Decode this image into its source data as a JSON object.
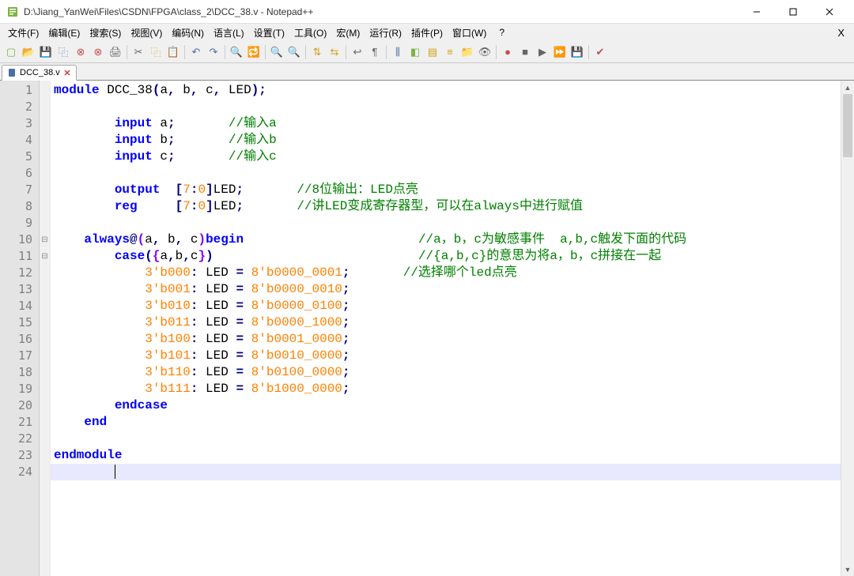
{
  "title": "D:\\Jiang_YanWei\\Files\\CSDN\\FPGA\\class_2\\DCC_38.v - Notepad++",
  "menus": [
    "文件(F)",
    "编辑(E)",
    "搜索(S)",
    "视图(V)",
    "编码(N)",
    "语言(L)",
    "设置(T)",
    "工具(O)",
    "宏(M)",
    "运行(R)",
    "插件(P)",
    "窗口(W)"
  ],
  "menu_help": "?",
  "menu_x": "X",
  "tab": {
    "label": "DCC_38.v"
  },
  "lines": [
    {
      "n": 1,
      "seg": [
        {
          "c": "kw",
          "t": "module"
        },
        {
          "t": " DCC_38"
        },
        {
          "c": "op",
          "t": "("
        },
        {
          "t": "a"
        },
        {
          "c": "op",
          "t": ","
        },
        {
          "t": " b"
        },
        {
          "c": "op",
          "t": ","
        },
        {
          "t": " c"
        },
        {
          "c": "op",
          "t": ","
        },
        {
          "t": " LED"
        },
        {
          "c": "op",
          "t": ")"
        },
        {
          "c": "op",
          "t": ";"
        }
      ]
    },
    {
      "n": 2,
      "seg": []
    },
    {
      "n": 3,
      "seg": [
        {
          "t": "        "
        },
        {
          "c": "kw",
          "t": "input"
        },
        {
          "t": " a"
        },
        {
          "c": "op",
          "t": ";"
        },
        {
          "t": "       "
        },
        {
          "c": "cm",
          "t": "//输入a"
        }
      ]
    },
    {
      "n": 4,
      "seg": [
        {
          "t": "        "
        },
        {
          "c": "kw",
          "t": "input"
        },
        {
          "t": " b"
        },
        {
          "c": "op",
          "t": ";"
        },
        {
          "t": "       "
        },
        {
          "c": "cm",
          "t": "//输入b"
        }
      ]
    },
    {
      "n": 5,
      "seg": [
        {
          "t": "        "
        },
        {
          "c": "kw",
          "t": "input"
        },
        {
          "t": " c"
        },
        {
          "c": "op",
          "t": ";"
        },
        {
          "t": "       "
        },
        {
          "c": "cm",
          "t": "//输入c"
        }
      ]
    },
    {
      "n": 6,
      "seg": []
    },
    {
      "n": 7,
      "seg": [
        {
          "t": "        "
        },
        {
          "c": "kw",
          "t": "output"
        },
        {
          "t": "  "
        },
        {
          "c": "op",
          "t": "["
        },
        {
          "c": "nm",
          "t": "7"
        },
        {
          "c": "op",
          "t": ":"
        },
        {
          "c": "nm",
          "t": "0"
        },
        {
          "c": "op",
          "t": "]"
        },
        {
          "t": "LED"
        },
        {
          "c": "op",
          "t": ";"
        },
        {
          "t": "       "
        },
        {
          "c": "cm",
          "t": "//8位输出：LED点亮"
        }
      ]
    },
    {
      "n": 8,
      "seg": [
        {
          "t": "        "
        },
        {
          "c": "kw",
          "t": "reg"
        },
        {
          "t": "     "
        },
        {
          "c": "op",
          "t": "["
        },
        {
          "c": "nm",
          "t": "7"
        },
        {
          "c": "op",
          "t": ":"
        },
        {
          "c": "nm",
          "t": "0"
        },
        {
          "c": "op",
          "t": "]"
        },
        {
          "t": "LED"
        },
        {
          "c": "op",
          "t": ";"
        },
        {
          "t": "       "
        },
        {
          "c": "cm",
          "t": "//讲LED变成寄存器型，可以在always中进行赋值"
        }
      ]
    },
    {
      "n": 9,
      "seg": []
    },
    {
      "n": 10,
      "fold": "⊟",
      "seg": [
        {
          "t": "    "
        },
        {
          "c": "kw",
          "t": "always"
        },
        {
          "c": "op",
          "t": "@"
        },
        {
          "c": "br",
          "t": "("
        },
        {
          "t": "a"
        },
        {
          "c": "op",
          "t": ","
        },
        {
          "t": " b"
        },
        {
          "c": "op",
          "t": ","
        },
        {
          "t": " c"
        },
        {
          "c": "br",
          "t": ")"
        },
        {
          "c": "kw",
          "t": "begin"
        },
        {
          "t": "                       "
        },
        {
          "c": "cm",
          "t": "//a，b，c为敏感事件  a,b,c触发下面的代码"
        }
      ]
    },
    {
      "n": 11,
      "fold": "⊟",
      "seg": [
        {
          "t": "        "
        },
        {
          "c": "kw",
          "t": "case"
        },
        {
          "c": "op",
          "t": "("
        },
        {
          "c": "br",
          "t": "{"
        },
        {
          "t": "a"
        },
        {
          "c": "op",
          "t": ","
        },
        {
          "t": "b"
        },
        {
          "c": "op",
          "t": ","
        },
        {
          "t": "c"
        },
        {
          "c": "br",
          "t": "}"
        },
        {
          "c": "op",
          "t": ")"
        },
        {
          "t": "                           "
        },
        {
          "c": "cm",
          "t": "//{a,b,c}的意思为将a，b，c拼接在一起"
        }
      ]
    },
    {
      "n": 12,
      "seg": [
        {
          "t": "            "
        },
        {
          "c": "nm",
          "t": "3'b000"
        },
        {
          "c": "op",
          "t": ":"
        },
        {
          "t": " LED "
        },
        {
          "c": "op",
          "t": "="
        },
        {
          "t": " "
        },
        {
          "c": "nm",
          "t": "8'b0000_0001"
        },
        {
          "c": "op",
          "t": ";"
        },
        {
          "t": "       "
        },
        {
          "c": "cm",
          "t": "//选择哪个led点亮"
        }
      ]
    },
    {
      "n": 13,
      "seg": [
        {
          "t": "            "
        },
        {
          "c": "nm",
          "t": "3'b001"
        },
        {
          "c": "op",
          "t": ":"
        },
        {
          "t": " LED "
        },
        {
          "c": "op",
          "t": "="
        },
        {
          "t": " "
        },
        {
          "c": "nm",
          "t": "8'b0000_0010"
        },
        {
          "c": "op",
          "t": ";"
        }
      ]
    },
    {
      "n": 14,
      "seg": [
        {
          "t": "            "
        },
        {
          "c": "nm",
          "t": "3'b010"
        },
        {
          "c": "op",
          "t": ":"
        },
        {
          "t": " LED "
        },
        {
          "c": "op",
          "t": "="
        },
        {
          "t": " "
        },
        {
          "c": "nm",
          "t": "8'b0000_0100"
        },
        {
          "c": "op",
          "t": ";"
        }
      ]
    },
    {
      "n": 15,
      "seg": [
        {
          "t": "            "
        },
        {
          "c": "nm",
          "t": "3'b011"
        },
        {
          "c": "op",
          "t": ":"
        },
        {
          "t": " LED "
        },
        {
          "c": "op",
          "t": "="
        },
        {
          "t": " "
        },
        {
          "c": "nm",
          "t": "8'b0000_1000"
        },
        {
          "c": "op",
          "t": ";"
        }
      ]
    },
    {
      "n": 16,
      "seg": [
        {
          "t": "            "
        },
        {
          "c": "nm",
          "t": "3'b100"
        },
        {
          "c": "op",
          "t": ":"
        },
        {
          "t": " LED "
        },
        {
          "c": "op",
          "t": "="
        },
        {
          "t": " "
        },
        {
          "c": "nm",
          "t": "8'b0001_0000"
        },
        {
          "c": "op",
          "t": ";"
        }
      ]
    },
    {
      "n": 17,
      "seg": [
        {
          "t": "            "
        },
        {
          "c": "nm",
          "t": "3'b101"
        },
        {
          "c": "op",
          "t": ":"
        },
        {
          "t": " LED "
        },
        {
          "c": "op",
          "t": "="
        },
        {
          "t": " "
        },
        {
          "c": "nm",
          "t": "8'b0010_0000"
        },
        {
          "c": "op",
          "t": ";"
        }
      ]
    },
    {
      "n": 18,
      "seg": [
        {
          "t": "            "
        },
        {
          "c": "nm",
          "t": "3'b110"
        },
        {
          "c": "op",
          "t": ":"
        },
        {
          "t": " LED "
        },
        {
          "c": "op",
          "t": "="
        },
        {
          "t": " "
        },
        {
          "c": "nm",
          "t": "8'b0100_0000"
        },
        {
          "c": "op",
          "t": ";"
        }
      ]
    },
    {
      "n": 19,
      "seg": [
        {
          "t": "            "
        },
        {
          "c": "nm",
          "t": "3'b111"
        },
        {
          "c": "op",
          "t": ":"
        },
        {
          "t": " LED "
        },
        {
          "c": "op",
          "t": "="
        },
        {
          "t": " "
        },
        {
          "c": "nm",
          "t": "8'b1000_0000"
        },
        {
          "c": "op",
          "t": ";"
        }
      ]
    },
    {
      "n": 20,
      "seg": [
        {
          "t": "        "
        },
        {
          "c": "kw",
          "t": "endcase"
        }
      ]
    },
    {
      "n": 21,
      "seg": [
        {
          "t": "    "
        },
        {
          "c": "kw",
          "t": "end"
        }
      ]
    },
    {
      "n": 22,
      "seg": []
    },
    {
      "n": 23,
      "seg": [
        {
          "c": "kw",
          "t": "endmodule"
        }
      ]
    },
    {
      "n": 24,
      "current": true,
      "seg": [
        {
          "t": "        "
        }
      ]
    }
  ],
  "toolbar_icons": [
    {
      "name": "new-file-icon",
      "color": "#7cb342",
      "glyph": "▢"
    },
    {
      "name": "open-icon",
      "color": "#d4a017",
      "glyph": "📂"
    },
    {
      "name": "save-icon",
      "color": "#4a6fa5",
      "glyph": "💾"
    },
    {
      "name": "save-all-icon",
      "color": "#4a6fa5",
      "glyph": "⿻"
    },
    {
      "name": "close-file-icon",
      "color": "#c0504d",
      "glyph": "⊗"
    },
    {
      "name": "close-all-icon",
      "color": "#c0504d",
      "glyph": "⊗"
    },
    {
      "name": "print-icon",
      "color": "#666",
      "glyph": "🖨"
    },
    "sep",
    {
      "name": "cut-icon",
      "color": "#666",
      "glyph": "✂"
    },
    {
      "name": "copy-icon",
      "color": "#d4a017",
      "glyph": "⿻"
    },
    {
      "name": "paste-icon",
      "color": "#d4a017",
      "glyph": "📋"
    },
    "sep",
    {
      "name": "undo-icon",
      "color": "#4a6fa5",
      "glyph": "↶"
    },
    {
      "name": "redo-icon",
      "color": "#4a6fa5",
      "glyph": "↷"
    },
    "sep",
    {
      "name": "find-icon",
      "color": "#666",
      "glyph": "🔍"
    },
    {
      "name": "replace-icon",
      "color": "#666",
      "glyph": "🔁"
    },
    "sep",
    {
      "name": "zoom-in-icon",
      "color": "#666",
      "glyph": "🔍"
    },
    {
      "name": "zoom-out-icon",
      "color": "#666",
      "glyph": "🔍"
    },
    "sep",
    {
      "name": "sync-v-icon",
      "color": "#d4a017",
      "glyph": "⇅"
    },
    {
      "name": "sync-h-icon",
      "color": "#d4a017",
      "glyph": "⇆"
    },
    "sep",
    {
      "name": "wrap-icon",
      "color": "#666",
      "glyph": "↩"
    },
    {
      "name": "show-all-icon",
      "color": "#666",
      "glyph": "¶"
    },
    "sep",
    {
      "name": "indent-guide-icon",
      "color": "#4a6fa5",
      "glyph": "⫼"
    },
    {
      "name": "lang-icon",
      "color": "#7cb342",
      "glyph": "◧"
    },
    {
      "name": "doc-map-icon",
      "color": "#d4a017",
      "glyph": "▤"
    },
    {
      "name": "func-list-icon",
      "color": "#d4a017",
      "glyph": "≡"
    },
    {
      "name": "folder-icon",
      "color": "#d4a017",
      "glyph": "📁"
    },
    {
      "name": "monitor-icon",
      "color": "#666",
      "glyph": "👁"
    },
    "sep",
    {
      "name": "record-icon",
      "color": "#c0504d",
      "glyph": "●"
    },
    {
      "name": "stop-icon",
      "color": "#666",
      "glyph": "■"
    },
    {
      "name": "play-icon",
      "color": "#666",
      "glyph": "▶"
    },
    {
      "name": "play-multi-icon",
      "color": "#666",
      "glyph": "⏩"
    },
    {
      "name": "save-macro-icon",
      "color": "#4a6fa5",
      "glyph": "💾"
    },
    "sep",
    {
      "name": "spellcheck-icon",
      "color": "#c0504d",
      "glyph": "✔"
    }
  ]
}
